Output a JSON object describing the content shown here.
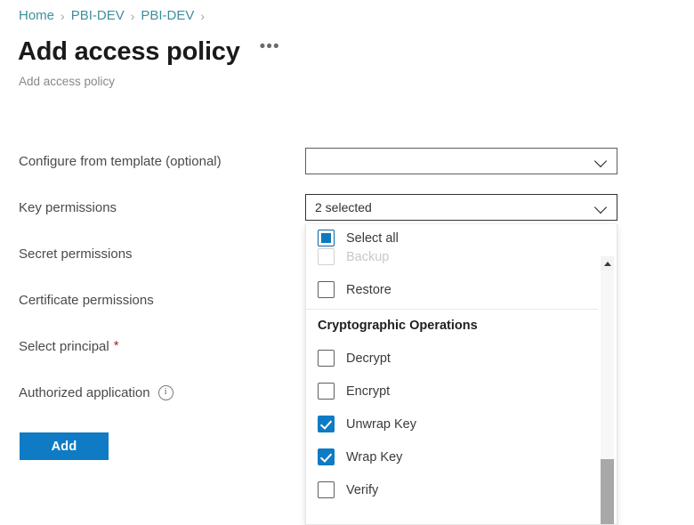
{
  "breadcrumb": {
    "items": [
      {
        "label": "Home"
      },
      {
        "label": "PBI-DEV"
      },
      {
        "label": "PBI-DEV"
      }
    ],
    "separator": "›"
  },
  "header": {
    "title": "Add access policy",
    "subtitle": "Add access policy",
    "more_label": "•••"
  },
  "form": {
    "rows": [
      {
        "label": "Configure from template (optional)",
        "required": false,
        "info": false
      },
      {
        "label": "Key permissions",
        "required": false,
        "info": false
      },
      {
        "label": "Secret permissions",
        "required": false,
        "info": false
      },
      {
        "label": "Certificate permissions",
        "required": false,
        "info": false
      },
      {
        "label": "Select principal",
        "required": true,
        "info": false
      },
      {
        "label": "Authorized application",
        "required": false,
        "info": true
      }
    ],
    "required_marker": "*",
    "info_glyph": "i"
  },
  "controls": {
    "template_dropdown": {
      "value": "",
      "placeholder": ""
    },
    "key_permissions_dropdown": {
      "value": "2 selected",
      "selected_count": 2
    }
  },
  "dropdown": {
    "select_all": {
      "label": "Select all",
      "state": "indeterminate"
    },
    "clipped_item": {
      "label": "Backup",
      "checked": false
    },
    "items_top": [
      {
        "label": "Restore",
        "checked": false
      }
    ],
    "group": {
      "label": "Cryptographic Operations"
    },
    "items_group": [
      {
        "label": "Decrypt",
        "checked": false
      },
      {
        "label": "Encrypt",
        "checked": false
      },
      {
        "label": "Unwrap Key",
        "checked": true
      },
      {
        "label": "Wrap Key",
        "checked": true
      },
      {
        "label": "Verify",
        "checked": false
      }
    ]
  },
  "actions": {
    "add_label": "Add"
  },
  "colors": {
    "accent": "#0f7bc4",
    "link": "#3e8f9b",
    "required": "#a4262c",
    "border": "#605e5c",
    "scrollbar_thumb": "#a8a8a8"
  }
}
